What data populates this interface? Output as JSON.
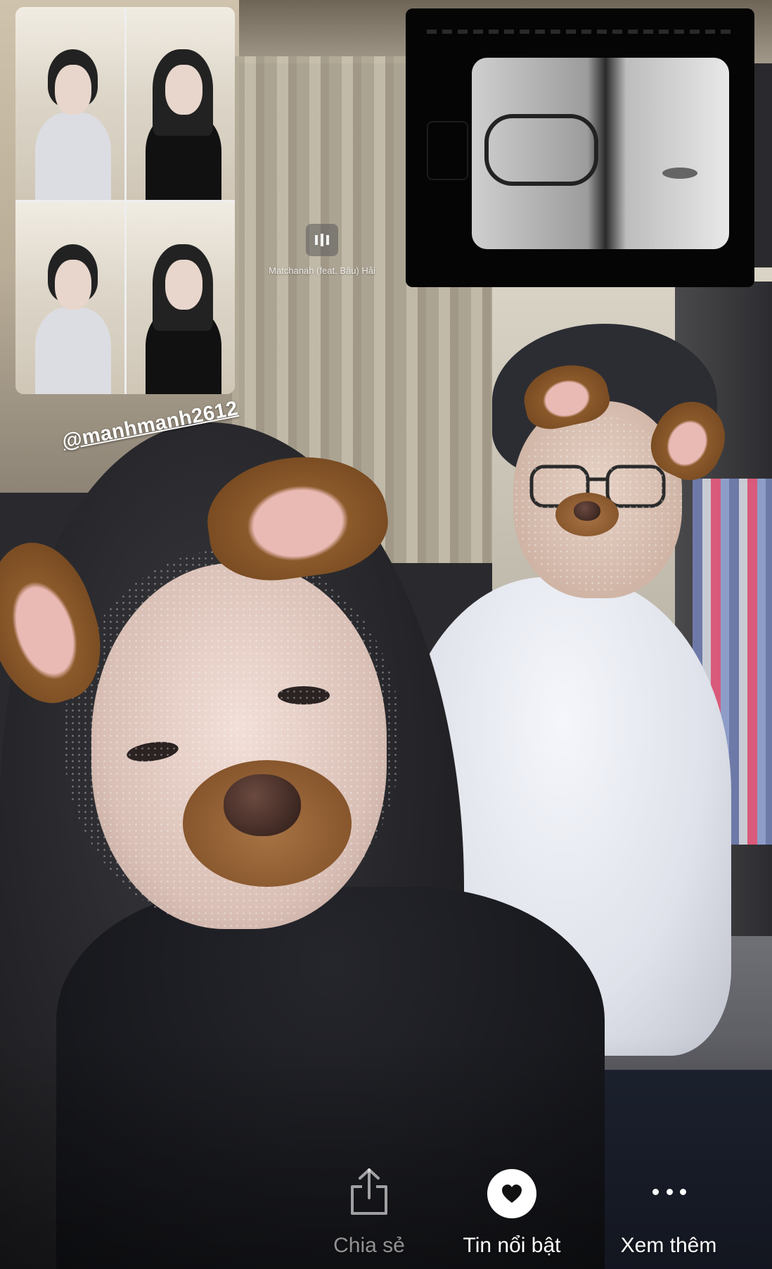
{
  "story": {
    "mention": "@manhmanh2612",
    "music": {
      "icon": "pause-music-icon",
      "title": "Matchanah (feat. Bâu) Hải"
    }
  },
  "actions": {
    "share": {
      "label": "Chia sẻ",
      "icon": "share-icon"
    },
    "highlight": {
      "label": "Tin nổi bật",
      "icon": "heart-icon"
    },
    "more": {
      "label": "Xem thêm",
      "icon": "more-dots-icon"
    }
  },
  "colors": {
    "dog_filter_brown": "#8b5a2b",
    "accent_white": "#ffffff"
  }
}
